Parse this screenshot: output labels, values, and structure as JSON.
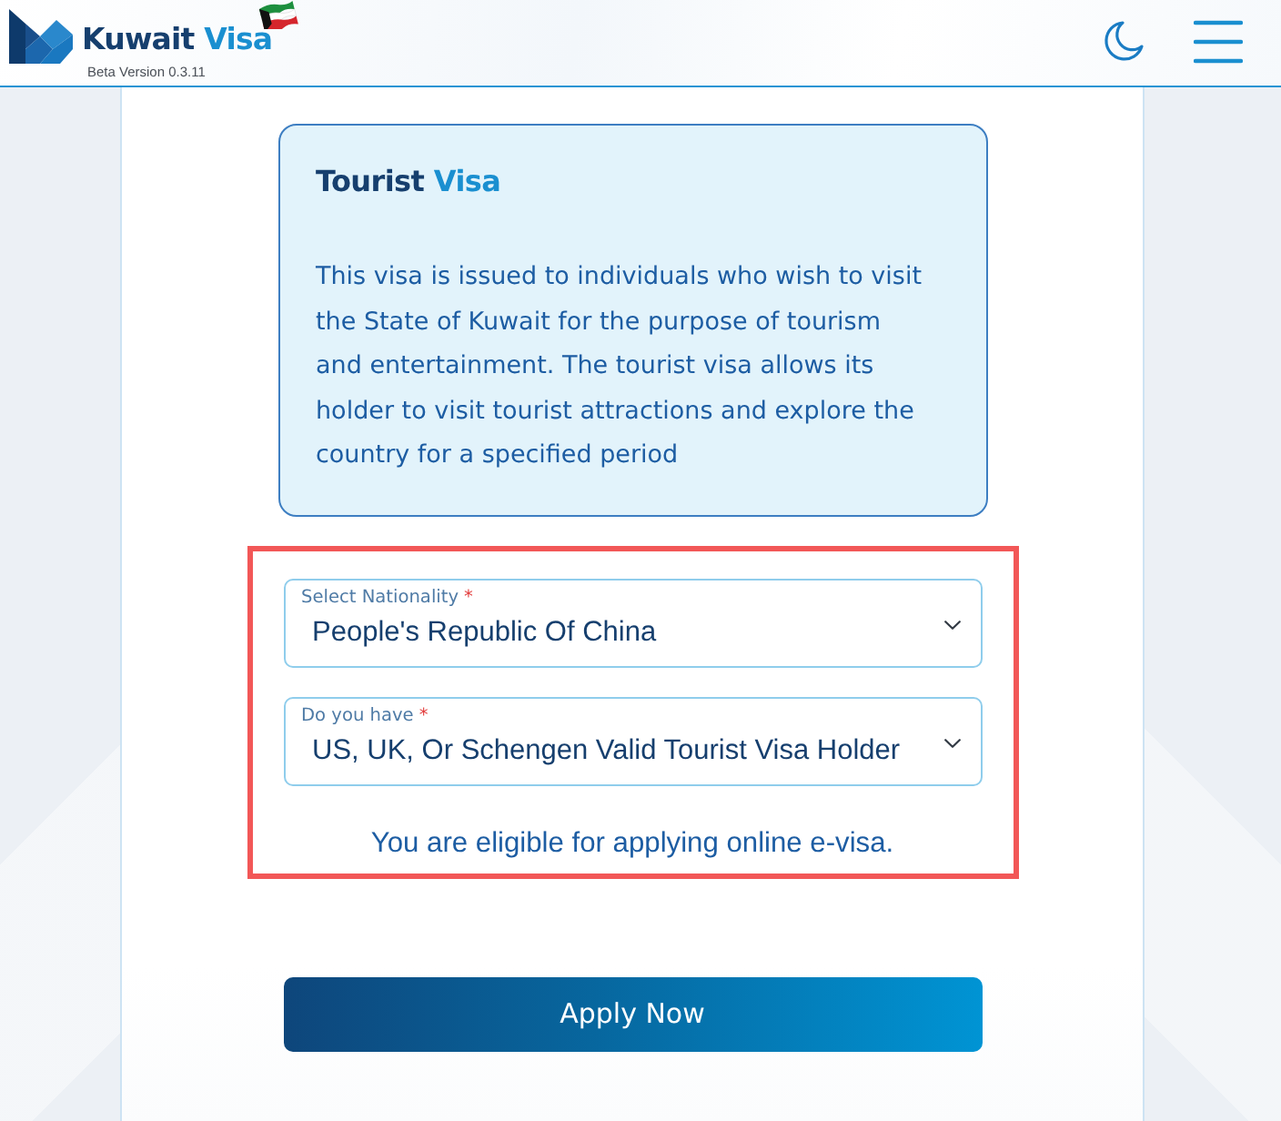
{
  "header": {
    "logo": {
      "lead": "Kuwait",
      "accent": "Visa"
    },
    "version": "Beta Version 0.3.11"
  },
  "info_card": {
    "title": {
      "lead": "Tourist",
      "accent": "Visa"
    },
    "description": "This visa is issued to individuals who wish to visit the State of Kuwait for the purpose of tourism and entertainment. The tourist visa allows its holder to visit tourist attractions and explore the country for a specified period"
  },
  "eligibility_panel": {
    "highlighted": true,
    "selects": [
      {
        "label": "Select Nationality",
        "required_mark": "*",
        "value": "People's Republic Of China"
      },
      {
        "label": "Do you have",
        "required_mark": "*",
        "value": "US, UK, Or Schengen Valid Tourist Visa Holder"
      }
    ],
    "message": "You are eligible for applying online e-visa."
  },
  "apply_button": {
    "label": "Apply Now"
  }
}
